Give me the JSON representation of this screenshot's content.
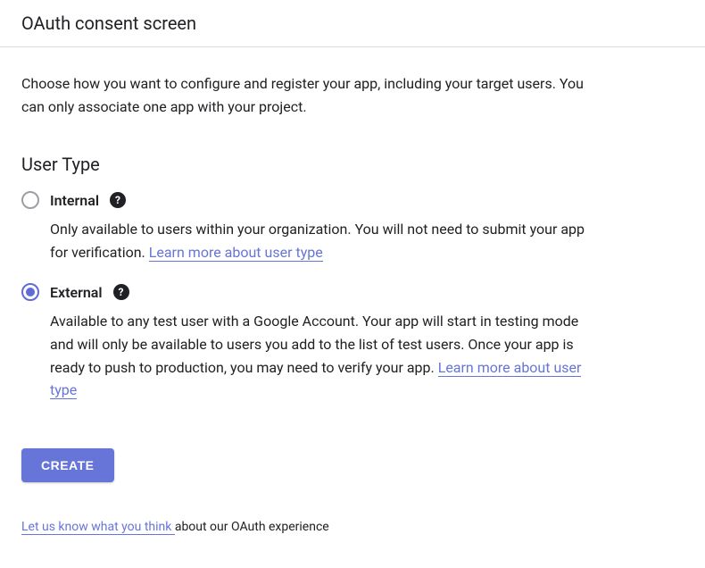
{
  "header": {
    "title": "OAuth consent screen"
  },
  "intro": "Choose how you want to configure and register your app, including your target users. You can only associate one app with your project.",
  "userType": {
    "title": "User Type",
    "options": {
      "internal": {
        "label": "Internal",
        "selected": false,
        "description": "Only available to users within your organization. You will not need to submit your app for verification. ",
        "link": "Learn more about user type"
      },
      "external": {
        "label": "External",
        "selected": true,
        "description": "Available to any test user with a Google Account. Your app will start in testing mode and will only be available to users you add to the list of test users. Once your app is ready to push to production, you may need to verify your app. ",
        "link": "Learn more about user type"
      }
    }
  },
  "createButton": "CREATE",
  "feedback": {
    "link": "Let us know what you think ",
    "text": "about our OAuth experience"
  }
}
